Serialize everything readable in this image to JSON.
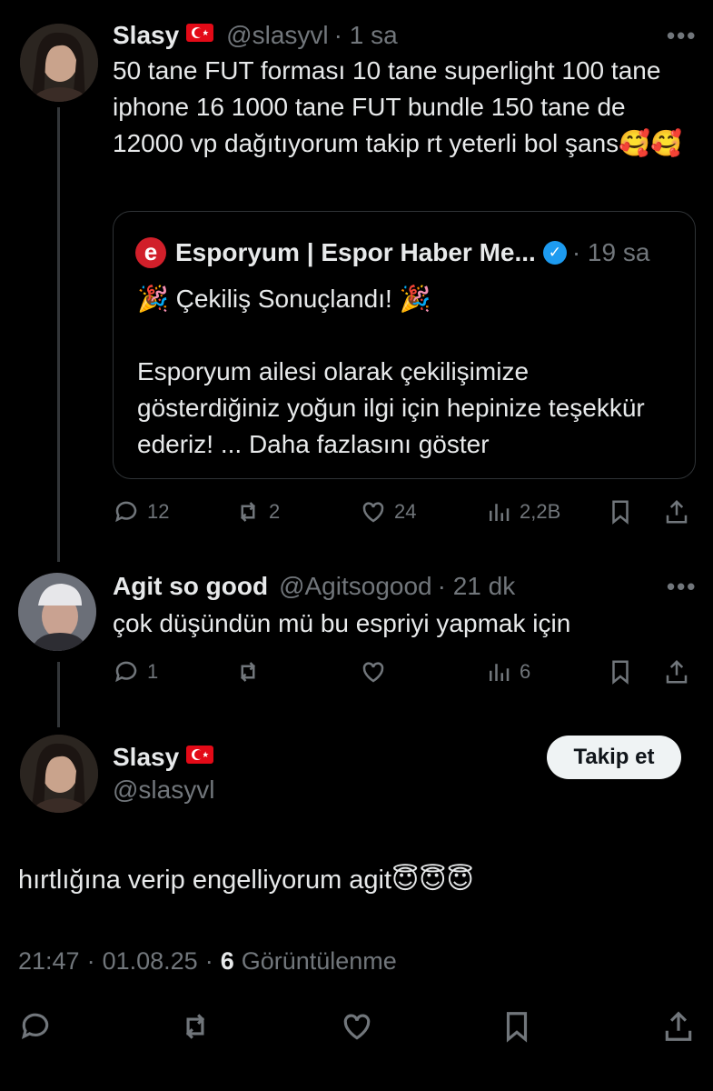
{
  "tweet1": {
    "name": "Slasy",
    "handle": "@slasyvl",
    "time": "· 1 sa",
    "more": "•••",
    "text": "50 tane FUT forması 10 tane superlight 100 tane iphone 16 1000 tane FUT bundle 150 tane de 12000 vp dağıtıyorum takip rt yeterli bol şans🥰🥰",
    "quote": {
      "name": "Esporyum | Espor Haber Me...",
      "time": "· 19 sa",
      "title": "🎉 Çekiliş Sonuçlandı! 🎉",
      "body": "Esporyum ailesi olarak çekilişimize gösterdiğiniz yoğun ilgi için hepinize teşekkür ederiz! ... Daha fazlasını göster"
    },
    "actions": {
      "replies": "12",
      "retweets": "2",
      "likes": "24",
      "views": "2,2B"
    }
  },
  "tweet2": {
    "name": "Agit so good",
    "handle": "@Agitsogood",
    "time": "· 21 dk",
    "more": "•••",
    "text": "çok düşündün mü bu espriyi yapmak için",
    "actions": {
      "replies": "1",
      "retweets": "",
      "likes": "",
      "views": "6"
    }
  },
  "main": {
    "name": "Slasy",
    "handle": "@slasyvl",
    "follow_label": "Takip et",
    "text": "hırtlığına verip engelliyorum agit😇😇😇",
    "time": "21:47",
    "date": "01.08.25",
    "views_count": "6",
    "views_label": "Görüntülenme",
    "sep": "·"
  },
  "colors": {
    "background": "#000000",
    "text": "#e7e9ea",
    "muted": "#71767b",
    "verified": "#1d9bf0",
    "flag": "#e30a17"
  },
  "icons": [
    "reply-icon",
    "retweet-icon",
    "like-icon",
    "views-icon",
    "bookmark-icon",
    "share-icon",
    "verified-icon",
    "more-icon"
  ]
}
